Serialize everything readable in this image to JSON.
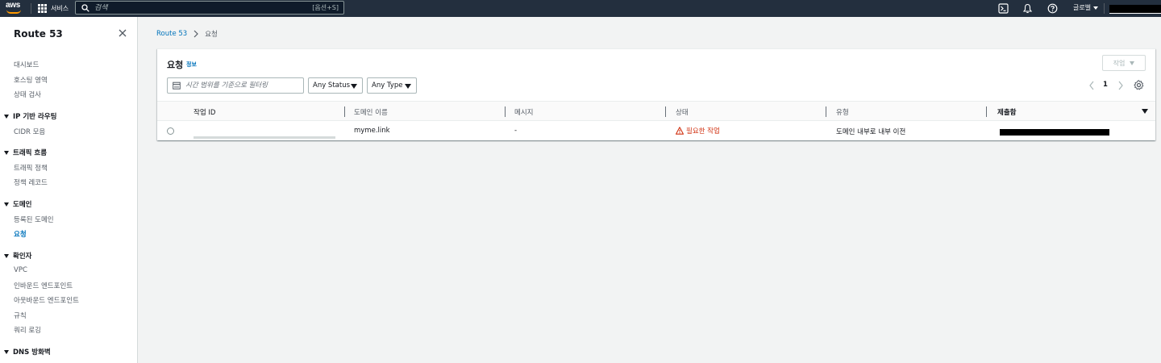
{
  "topnav": {
    "logo_text": "aws",
    "services_label": "서비스",
    "search_placeholder": "검색",
    "search_shortcut": "[옵션+S]",
    "region_label": "글로벌"
  },
  "sidebar": {
    "title": "Route 53",
    "top_items": [
      {
        "label": "대시보드"
      },
      {
        "label": "호스팅 영역"
      },
      {
        "label": "상태 검사"
      }
    ],
    "sections": [
      {
        "label": "IP 기반 라우팅",
        "items": [
          {
            "label": "CIDR 모음"
          }
        ]
      },
      {
        "label": "트래픽 흐름",
        "items": [
          {
            "label": "트래픽 정책"
          },
          {
            "label": "정책 레코드"
          }
        ]
      },
      {
        "label": "도메인",
        "items": [
          {
            "label": "등록된 도메인"
          },
          {
            "label": "요청",
            "active": true
          }
        ]
      },
      {
        "label": "확인자",
        "items": [
          {
            "label": "VPC"
          },
          {
            "label": "인바운드 엔드포인트"
          },
          {
            "label": "아웃바운드 엔드포인트"
          },
          {
            "label": "규칙"
          },
          {
            "label": "쿼리 로깅"
          }
        ]
      },
      {
        "label": "DNS 방화벽",
        "items": []
      }
    ]
  },
  "breadcrumb": {
    "root": "Route 53",
    "current": "요청"
  },
  "panel": {
    "title": "요청",
    "info_link": "정보",
    "action_button": "작업",
    "filter_placeholder": "시간 범위를 기준으로 필터링",
    "status_dropdown": "Any Status",
    "type_dropdown": "Any Type",
    "current_page": "1"
  },
  "table": {
    "columns": [
      "작업 ID",
      "도메인 이름",
      "메시지",
      "상태",
      "유형",
      "제출함"
    ],
    "rows": [
      {
        "domain": "myme.link",
        "message": "-",
        "status": "필요한 작업",
        "type": "도메인 내부로 내부 이전"
      }
    ]
  },
  "colors": {
    "nav_bg": "#232f3e",
    "link": "#0073bb",
    "warning": "#d13212",
    "aws_orange": "#ff9900"
  }
}
